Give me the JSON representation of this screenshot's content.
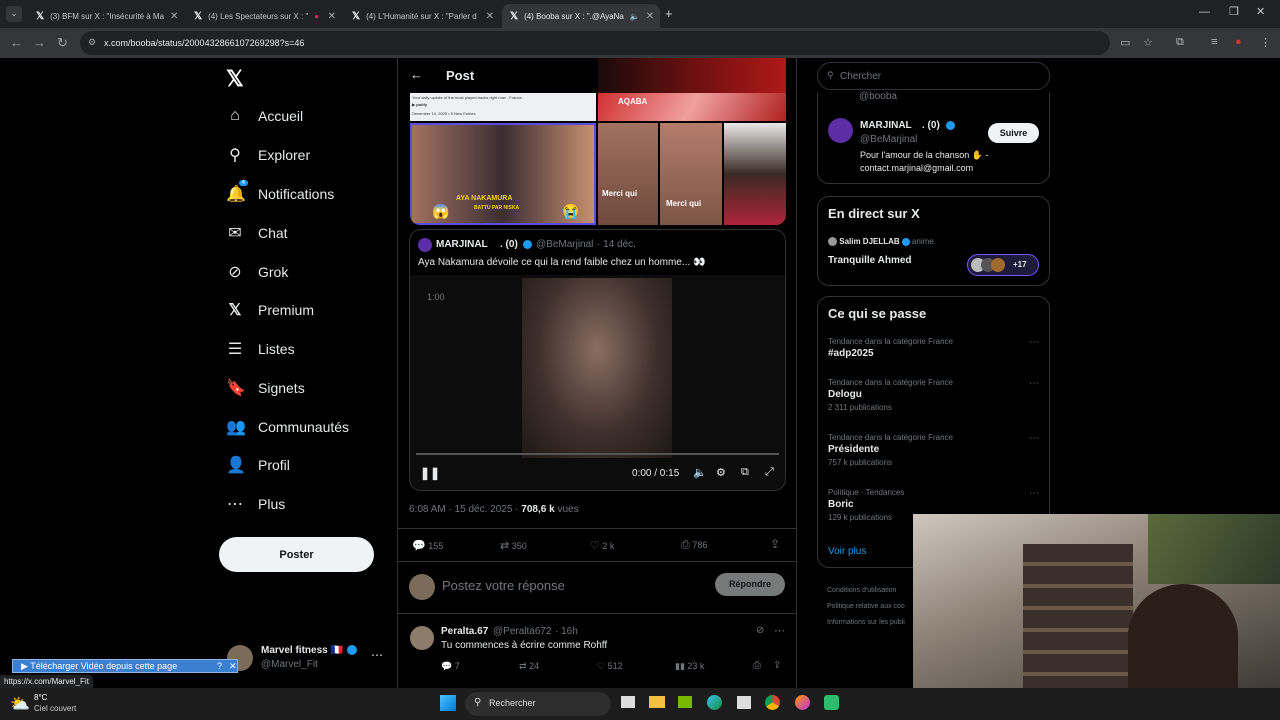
{
  "browser": {
    "tabs": [
      {
        "label": "(3) BFM sur X : \"Insécurité à Ma"
      },
      {
        "label": "(4) Les Spectateurs sur X : \""
      },
      {
        "label": "(4) L'Humanité sur X : \"Parler d"
      },
      {
        "label": "(4) Booba sur X : \".@AyaNa"
      }
    ],
    "url": "x.com/booba/status/2000432866107269298?s=46"
  },
  "nav": {
    "items": [
      {
        "label": "Accueil",
        "icon": "home-icon"
      },
      {
        "label": "Explorer",
        "icon": "search-icon"
      },
      {
        "label": "Notifications",
        "icon": "bell-icon",
        "badge": "4"
      },
      {
        "label": "Chat",
        "icon": "mail-icon"
      },
      {
        "label": "Grok",
        "icon": "grok-icon"
      },
      {
        "label": "Premium",
        "icon": "x-icon"
      },
      {
        "label": "Listes",
        "icon": "list-icon"
      },
      {
        "label": "Signets",
        "icon": "bookmark-icon"
      },
      {
        "label": "Communautés",
        "icon": "people-icon"
      },
      {
        "label": "Profil",
        "icon": "user-icon"
      },
      {
        "label": "Plus",
        "icon": "more-icon"
      }
    ],
    "post_button": "Poster",
    "account": {
      "name": "Marvel fitness 🇫🇷",
      "handle": "@Marvel_Fit"
    }
  },
  "post": {
    "header": "Post",
    "quote": {
      "author": "MARJINAL",
      "author_suffix": ". (0)",
      "handle": "@BeMarjinal",
      "date": "· 14 déc.",
      "text": "Aya Nakamura dévoile ce qui la rend faible chez un homme... 👀",
      "video_overlay": "1:00"
    },
    "thumbs_caption_a": "AYA NAKAMURA",
    "thumbs_caption_b": "BATTU PAR NISKA",
    "thumbs_caption_c": "Merci qui",
    "thumbs_caption_d": "Merci qui",
    "thumbs_caption_e": "AQABA",
    "spotify_lines": [
      "Your daily update of the most played tracks right now - France.",
      "December 14, 2025 • 5 New Entries"
    ],
    "video_time": "0:00 / 0:15",
    "meta_time": "6:08 AM · 15 déc. 2025 · ",
    "views": "708,6 k",
    "views_label": " vues",
    "stats": {
      "replies": "155",
      "reposts": "350",
      "likes": "2 k",
      "bookmarks": "786"
    },
    "reply_placeholder": "Postez votre réponse",
    "reply_button": "Répondre"
  },
  "reply": {
    "author": "Peralta.67",
    "handle": "@Peralta672",
    "time": "· 16h",
    "text": "Tu commences à écrire comme Rohff",
    "stats": {
      "replies": "7",
      "reposts": "24",
      "likes": "512",
      "views": "23 k"
    }
  },
  "right": {
    "search_placeholder": "Chercher",
    "suggest_top_handle": "@booba",
    "suggest": {
      "name": "MARJINAL",
      "suffix": ". (0)",
      "handle": "@BeMarjinal",
      "bio": "Pour l'amour de la chanson ✋ - contact.marjinal@gmail.com",
      "button": "Suivre"
    },
    "live_title": "En direct sur X",
    "live_host": "Salim DJELLAB",
    "live_host_suffix": " anime.",
    "live_title_item": "Tranquille Ahmed",
    "live_count": "+17",
    "trends_title": "Ce qui se passe",
    "trends": [
      {
        "category": "Tendance dans la catégorie France",
        "name": "#adp2025",
        "count": ""
      },
      {
        "category": "Tendance dans la catégorie France",
        "name": "Delogu",
        "count": "2 311 publications"
      },
      {
        "category": "Tendance dans la catégorie France",
        "name": "Présidente",
        "count": "757 k publications"
      },
      {
        "category": "Politique · Tendances",
        "name": "Boric",
        "count": "129 k publications"
      }
    ],
    "see_more": "Voir plus",
    "footer": [
      "Conditions d'utilisation",
      "Politique relative aux coo",
      "Informations sur les publi"
    ]
  },
  "extension": {
    "label": "▶ Télécharger Vidéo depuis cette page"
  },
  "status_url": "https://x.com/Marvel_Fit",
  "taskbar": {
    "temp": "8°C",
    "weather": "Ciel couvert",
    "search": "Rechercher"
  }
}
